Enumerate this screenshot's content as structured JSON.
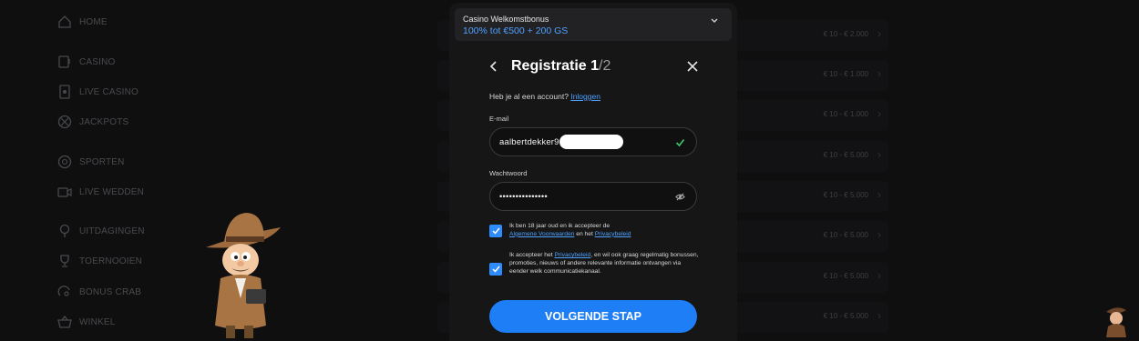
{
  "sidebar": {
    "items": [
      {
        "label": "HOME",
        "icon": "home-icon"
      },
      {
        "label": "CASINO",
        "icon": "slot-machine-icon"
      },
      {
        "label": "LIVE CASINO",
        "icon": "card-icon"
      },
      {
        "label": "JACKPOTS",
        "icon": "jackpot-icon"
      },
      {
        "label": "SPORTEN",
        "icon": "ball-icon"
      },
      {
        "label": "LIVE WEDDEN",
        "icon": "video-icon"
      },
      {
        "label": "UITDAGINGEN",
        "icon": "trophy-outline-icon"
      },
      {
        "label": "TOERNOOIEN",
        "icon": "cup-icon"
      },
      {
        "label": "BONUS CRAB",
        "icon": "crab-icon"
      },
      {
        "label": "WINKEL",
        "icon": "basket-icon"
      }
    ]
  },
  "background_rows": {
    "amounts": [
      "€ 10 - € 2.000",
      "€ 10 - € 1.000",
      "€ 10 - € 1.000",
      "€ 10 - € 5.000",
      "€ 10 - € 5.000",
      "€ 10 - € 5.000",
      "€ 10 - € 5.000",
      "€ 10 - € 5.000"
    ]
  },
  "bonus": {
    "title": "Casino Welkomstbonus",
    "value": "100% tot €500 + 200 GS"
  },
  "registration": {
    "title": "Registratie 1",
    "step": "/2",
    "account_question": "Heb je al een account?",
    "login_link": "Inloggen",
    "email_label": "E-mail",
    "email_value": "aalbertdekker9",
    "password_label": "Wachtwoord",
    "password_value": "•••••••••••••••",
    "terms_1_pre": "Ik ben 18 jaar oud en ik accepteer de",
    "terms_1_link_a": "Algemene Voorwaarden",
    "terms_1_mid": "en het",
    "terms_1_link_b": "Privacybeleid",
    "terms_2_pre": "Ik accepteer het",
    "terms_2_link": "Privacybeleid",
    "terms_2_post": ", en wil ook graag regelmatig bonussen, promoties, nieuws of andere relevante informatie ontvangen via eender welk communicatiekanaal.",
    "cta": "VOLGENDE STAP"
  },
  "colors": {
    "accent": "#1e7ef5",
    "link": "#4ea1ff",
    "modal_bg": "#161617",
    "page_bg": "#0f0f10"
  }
}
